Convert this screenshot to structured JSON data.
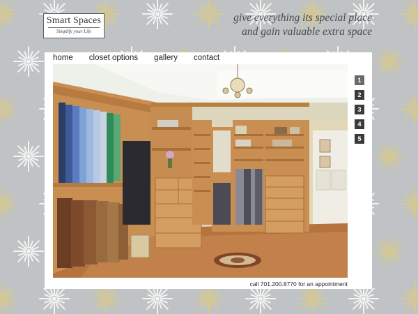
{
  "brand": {
    "name": "Smart Spaces",
    "tagline_small": "Simplify your Life"
  },
  "header": {
    "tagline_line1": "give everything its special place",
    "tagline_line2": "and gain valuable extra space"
  },
  "nav": {
    "items": [
      {
        "label": "home"
      },
      {
        "label": "closet options"
      },
      {
        "label": "gallery"
      },
      {
        "label": "contact"
      }
    ]
  },
  "pager": {
    "pages": [
      "1",
      "2",
      "3",
      "4",
      "5"
    ],
    "active": "1"
  },
  "footer": {
    "phone_note": "call 701.200.8770 for an appointment"
  },
  "colors": {
    "background": "#bfc3c5",
    "starburst_white": "#f4f4f2",
    "starburst_gold": "#d8c98a",
    "wood": "#c98e52",
    "pager_bg": "#3a3a3a"
  }
}
